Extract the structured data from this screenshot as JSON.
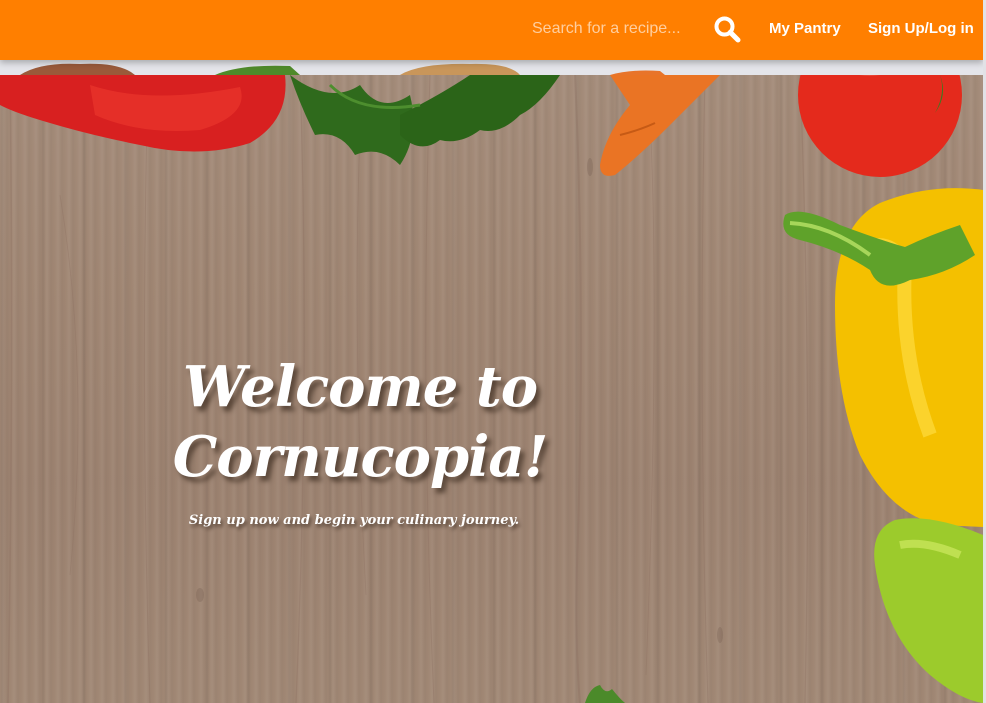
{
  "nav": {
    "search_placeholder": "Search for a recipe...",
    "search_icon": "search-icon",
    "my_pantry_label": "My Pantry",
    "signup_login_label": "Sign Up/Log in"
  },
  "hero": {
    "title": "Welcome to Cornucopia!",
    "subtitle": "Sign up now and begin your culinary journey."
  },
  "colors": {
    "nav_background": "#ff7f00",
    "text": "#ffffff"
  }
}
